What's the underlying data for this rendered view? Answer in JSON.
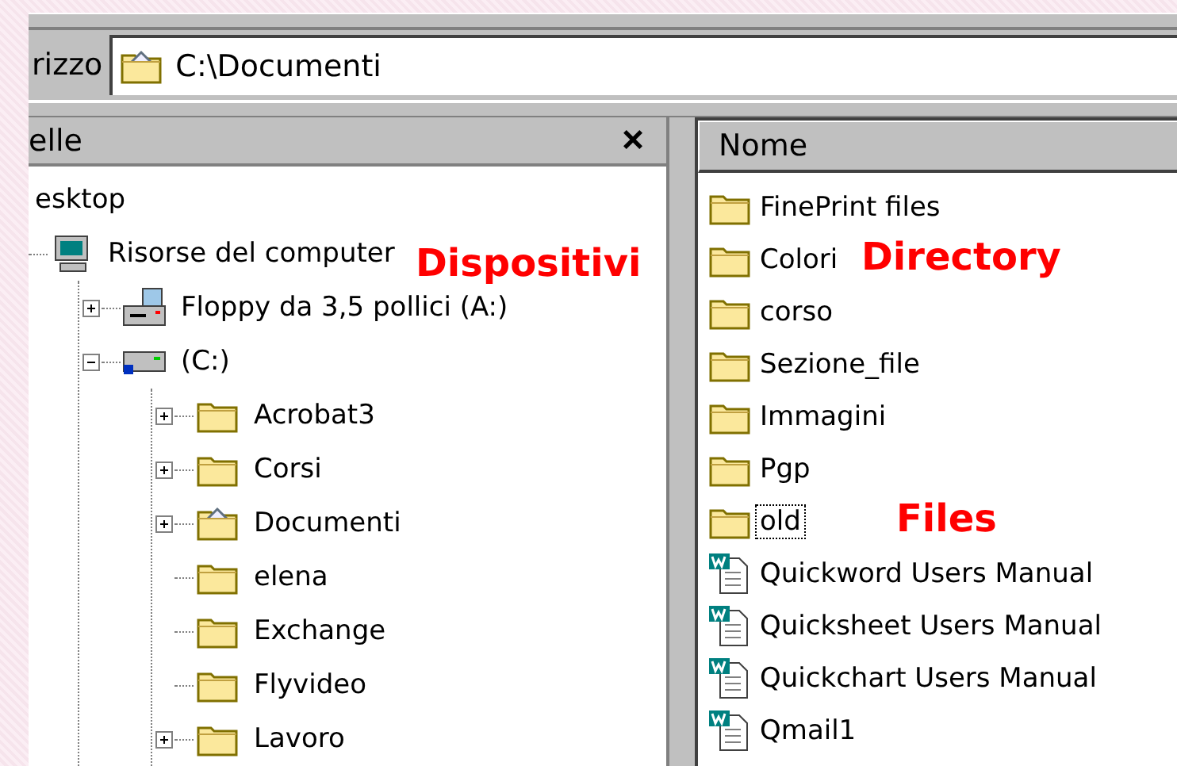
{
  "address_bar": {
    "label": "rizzo",
    "value": "C:\\Documenti"
  },
  "folders_pane": {
    "title": "elle",
    "close": "×",
    "tree": [
      {
        "label": "esktop",
        "children": [
          {
            "label": "Risorse del computer",
            "kind": "computer",
            "children": [
              {
                "label": "Floppy da 3,5 pollici (A:)",
                "kind": "floppy",
                "expanded": false
              },
              {
                "label": "(C:)",
                "kind": "drive",
                "expanded": true,
                "children": [
                  {
                    "label": "Acrobat3",
                    "kind": "folder",
                    "expanded": false
                  },
                  {
                    "label": "Corsi",
                    "kind": "folder",
                    "expanded": false
                  },
                  {
                    "label": "Documenti",
                    "kind": "special-folder",
                    "expanded": false
                  },
                  {
                    "label": "elena",
                    "kind": "folder"
                  },
                  {
                    "label": "Exchange",
                    "kind": "folder"
                  },
                  {
                    "label": "Flyvideo",
                    "kind": "folder"
                  },
                  {
                    "label": "Lavoro",
                    "kind": "folder",
                    "expanded": false
                  }
                ]
              }
            ]
          }
        ]
      }
    ]
  },
  "file_list": {
    "column": "Nome",
    "items": [
      {
        "name": "FinePrint files",
        "kind": "folder",
        "focused": false
      },
      {
        "name": "Colori",
        "kind": "folder",
        "focused": false
      },
      {
        "name": "corso",
        "kind": "folder",
        "focused": false
      },
      {
        "name": "Sezione_file",
        "kind": "folder",
        "focused": false
      },
      {
        "name": "Immagini",
        "kind": "folder",
        "focused": false
      },
      {
        "name": "Pgp",
        "kind": "folder",
        "focused": false
      },
      {
        "name": "old",
        "kind": "folder",
        "focused": true
      },
      {
        "name": "Quickword Users Manual",
        "kind": "document",
        "focused": false
      },
      {
        "name": "Quicksheet Users Manual",
        "kind": "document",
        "focused": false
      },
      {
        "name": "Quickchart Users Manual",
        "kind": "document",
        "focused": false
      },
      {
        "name": "Qmail1",
        "kind": "document",
        "focused": false
      }
    ]
  },
  "annotations": [
    {
      "text": "Dispositivi"
    },
    {
      "text": "Directory"
    },
    {
      "text": "Files"
    }
  ]
}
